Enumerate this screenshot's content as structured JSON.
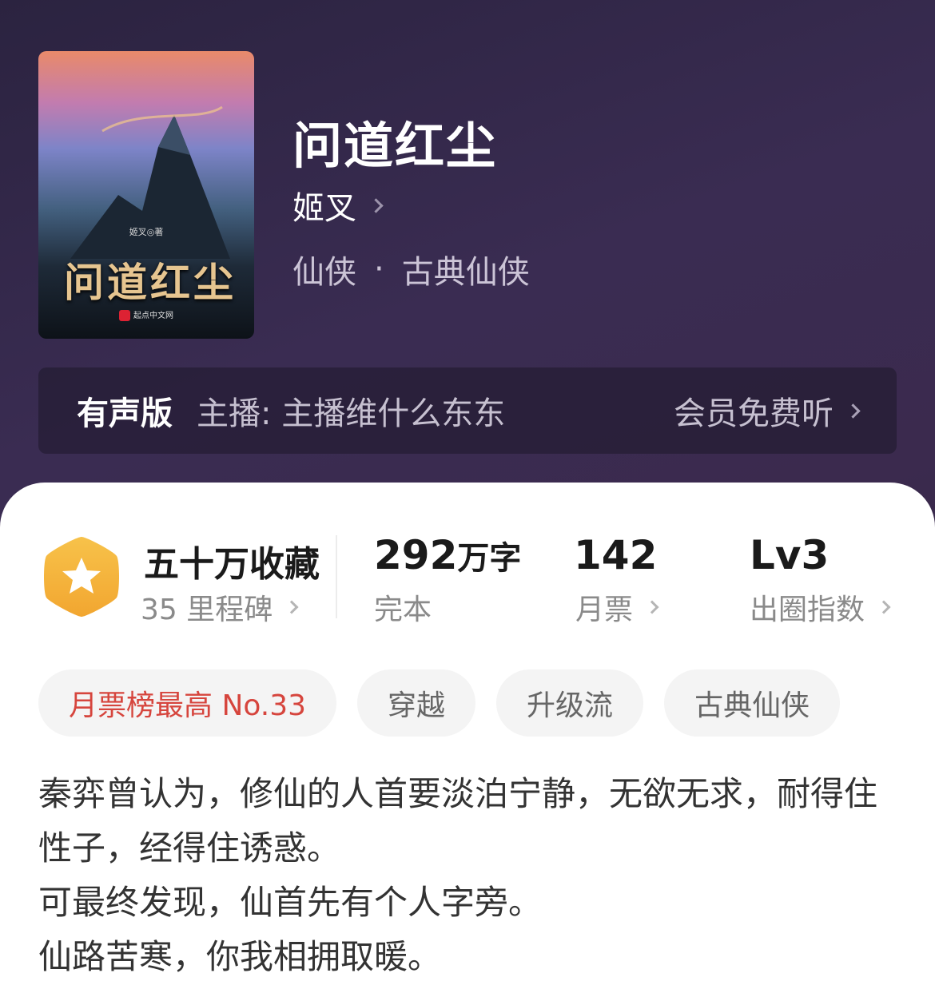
{
  "book": {
    "title": "问道红尘",
    "author": "姬叉",
    "category": "仙侠",
    "subcategory": "古典仙侠",
    "separator": "·"
  },
  "cover": {
    "title": "问道红尘",
    "author_line": "姬叉◎著",
    "publisher": "起点中文网"
  },
  "audio": {
    "label": "有声版",
    "host": "主播: 主播维什么东东",
    "cta": "会员免费听"
  },
  "stats": {
    "favorites": "五十万收藏",
    "milestones": "35 里程碑",
    "words_value": "292",
    "words_unit": "万字",
    "status": "完本",
    "monthly_votes": "142",
    "monthly_votes_label": "月票",
    "level": "Lv3",
    "level_label": "出圈指数"
  },
  "tags": [
    "月票榜最高 No.33",
    "穿越",
    "升级流",
    "古典仙侠"
  ],
  "description": [
    "秦弈曾认为，修仙的人首要淡泊宁静，无欲无求，耐得住性子，经得住诱惑。",
    "可最终发现，仙首先有个人字旁。",
    "仙路苦寒，你我相拥取暖。"
  ],
  "colors": {
    "header_bg": "#3a2c52",
    "rank_tag": "#d6453d",
    "badge_gold": "#f5b23a"
  }
}
